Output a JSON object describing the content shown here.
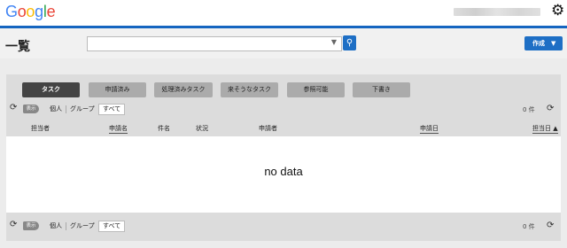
{
  "header": {
    "logo": [
      "G",
      "o",
      "o",
      "g",
      "l",
      "e"
    ],
    "settings_icon": "gear-icon"
  },
  "title": "一覧",
  "search": {
    "placeholder": "",
    "value": ""
  },
  "create_button": {
    "label": "作成",
    "arrow": "▼"
  },
  "tabs": [
    {
      "label": "タスク",
      "active": true
    },
    {
      "label": "申請済み",
      "active": false
    },
    {
      "label": "処理済みタスク",
      "active": false
    },
    {
      "label": "来そうなタスク",
      "active": false
    },
    {
      "label": "参照可能",
      "active": false
    },
    {
      "label": "下書き",
      "active": false
    }
  ],
  "filter": {
    "show_label": "表示",
    "options": [
      "個人",
      "グループ",
      "すべて"
    ],
    "selected": "すべて",
    "count": "0 件"
  },
  "columns": [
    {
      "label": "担当者",
      "sortable": false
    },
    {
      "label": "申請名",
      "sortable": true
    },
    {
      "label": "件名",
      "sortable": false
    },
    {
      "label": "状況",
      "sortable": false
    },
    {
      "label": "申請者",
      "sortable": false
    },
    {
      "label": "申請日",
      "sortable": true
    },
    {
      "label": "担当日 ▲",
      "sortable": true
    }
  ],
  "empty_message": "no data",
  "colors": {
    "brand_blue": "#1565c0",
    "button_blue": "#1e6fc5",
    "active_tab": "#444444"
  }
}
